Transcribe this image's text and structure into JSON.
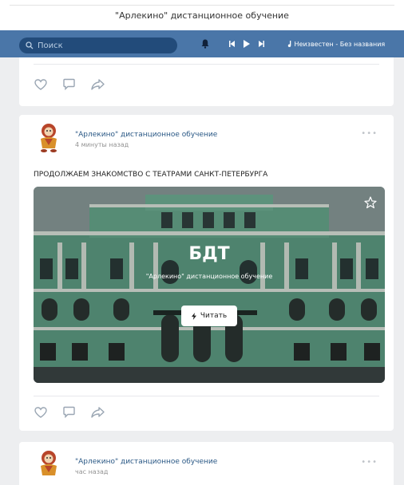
{
  "window": {
    "title": "\"Арлекино\" дистанционное обучение"
  },
  "header": {
    "search_placeholder": "Поиск",
    "track": "Неизвестен - Без названия"
  },
  "posts": [
    {
      "author": "\"Арлекино\" дистанционное обучение",
      "time": "4 минуты назад",
      "text": "ПРОДОЛЖАЕМ ЗНАКОМСТВО С ТЕАТРАМИ САНКТ-ПЕТЕРБУРГА",
      "article": {
        "title": "БДТ",
        "source": "\"Арлекино\" дистанционное обучение",
        "read_label": "Читать"
      }
    },
    {
      "author": "\"Арлекино\" дистанционное обучение",
      "time": "час назад"
    }
  ],
  "colors": {
    "header_bg": "#4a76a8",
    "link": "#2a5885",
    "page_bg": "#edeef0",
    "building": "#5f9e84"
  },
  "icons": {
    "action_bar": [
      "heart-icon",
      "comment-icon",
      "share-icon"
    ],
    "header": [
      "search-icon",
      "bell-icon",
      "prev-icon",
      "play-icon",
      "next-icon"
    ]
  }
}
